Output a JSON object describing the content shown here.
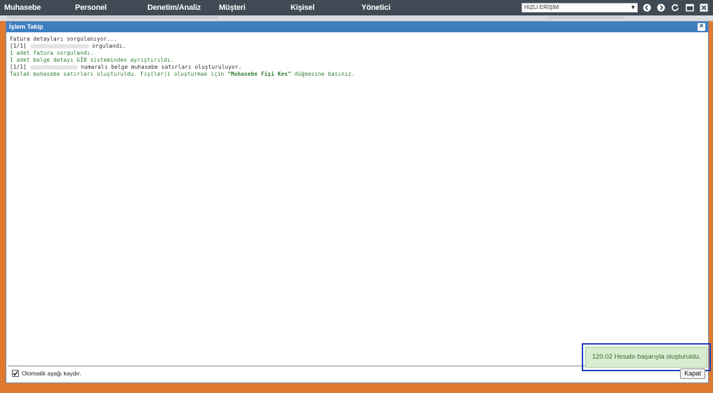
{
  "nav": {
    "items": [
      {
        "label": "Muhasebe"
      },
      {
        "label": "Personel"
      },
      {
        "label": "Denetim/Analiz"
      },
      {
        "label": "Müşteri"
      },
      {
        "label": "Kişisel"
      },
      {
        "label": "Yönetici"
      }
    ],
    "quick_access": "HIZLI ERİŞİM",
    "icons": [
      "back-icon",
      "forward-icon",
      "refresh-icon",
      "maximize-icon",
      "close-icon"
    ]
  },
  "dialog": {
    "title": "İşlem Takip",
    "close_label": "×",
    "log": {
      "line1": "Fatura detayları sorgulanıyor...",
      "line2_prefix": "[1/1] ",
      "line2_suffix": " orgulandı.",
      "line3": "1 adet fatura sorgulandı.",
      "line4": "1 adet belge detayı GİB sisteminden ayrıştırıldı.",
      "line5_prefix": "[1/1] ",
      "line5_suffix": " numaralı belge muhasebe satırları oluşturuluyor.",
      "line6_prefix": "Taslak muhasebe satırları oluşturuldu. Fiş(ler)i oluşturmak için ",
      "line6_strong": "\"Muhasebe Fişi Kes\"",
      "line6_suffix": " düğmesine basınız."
    },
    "toast": "120.02 Hesabı başarıyla oluşturuldu.",
    "auto_scroll_label": "Otomatik aşağı kaydır.",
    "auto_scroll_checked": true,
    "close_button": "Kapat"
  },
  "colors": {
    "frame": "#e07a2e",
    "topbar": "#3f4a55",
    "dialog_title": "#3f7fbf",
    "log_green": "#2e7d32",
    "toast_bg": "#d8ecd1",
    "toast_border_highlight": "#1f3fbf"
  }
}
